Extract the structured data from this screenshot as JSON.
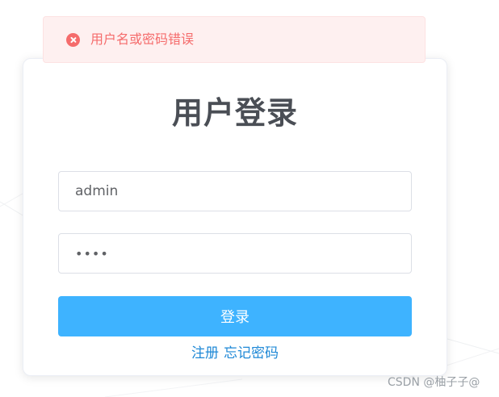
{
  "alert": {
    "icon": "close-circle-icon",
    "message": "用户名或密码错误",
    "color": "#f56c6c"
  },
  "login": {
    "title": "用户登录",
    "username_value": "admin",
    "password_value": "abcd",
    "submit_label": "登录",
    "register_link": "注册",
    "forgot_link": "忘记密码"
  },
  "colors": {
    "accent": "#3eb3ff",
    "link": "#1e88d6"
  },
  "watermark": "CSDN @柚子子@"
}
